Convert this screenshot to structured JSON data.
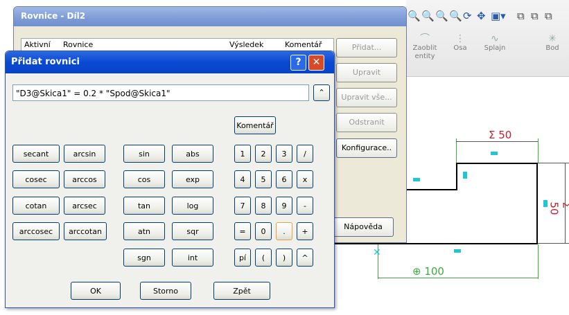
{
  "cad": {
    "tools": [
      {
        "label": "Zaoblit",
        "label2": "entity"
      },
      {
        "label": "Osa"
      },
      {
        "label": "Splajn"
      },
      {
        "label": "Bod"
      }
    ],
    "dims": {
      "top": "Σ 50",
      "right": "Σ 50",
      "bottom": "100"
    },
    "colors": {
      "accent_cyan": "#1fc7d4",
      "sketch_green": "#3fa83f",
      "dim_red": "#c0202a"
    }
  },
  "rovnice": {
    "title": "Rovnice - Díl2",
    "columns": [
      "Aktivní",
      "Rovnice",
      "Výsledek",
      "Komentář"
    ],
    "buttons": {
      "pridat": "Přidat...",
      "upravit": "Upravit",
      "upravit_vse": "Upravit vše...",
      "odstranit": "Odstranit",
      "konfigurace": "Konfigurace..",
      "napoveda": "Nápověda"
    }
  },
  "dialog": {
    "title": "Přidat rovnici",
    "help_symbol": "?",
    "close_symbol": "✕",
    "equation": "\"D3@Skica1\" = 0.2 * \"Spod@Skica1\"",
    "komentar": "Komentář",
    "functions": [
      [
        "secant",
        "arcsin",
        "sin",
        "abs"
      ],
      [
        "cosec",
        "arccos",
        "cos",
        "exp"
      ],
      [
        "cotan",
        "arcsec",
        "tan",
        "log"
      ],
      [
        "arccosec",
        "arccotan",
        "atn",
        "sqr"
      ],
      [
        "sgn",
        "int"
      ]
    ],
    "keys": [
      [
        "1",
        "2",
        "3",
        "/"
      ],
      [
        "4",
        "5",
        "6",
        "x"
      ],
      [
        "7",
        "8",
        "9",
        "-"
      ],
      [
        "=",
        "0",
        ".",
        "+"
      ],
      [
        "pí",
        "(",
        ")",
        "^"
      ]
    ],
    "ok": "OK",
    "storno": "Storno",
    "zpet": "Zpět"
  }
}
